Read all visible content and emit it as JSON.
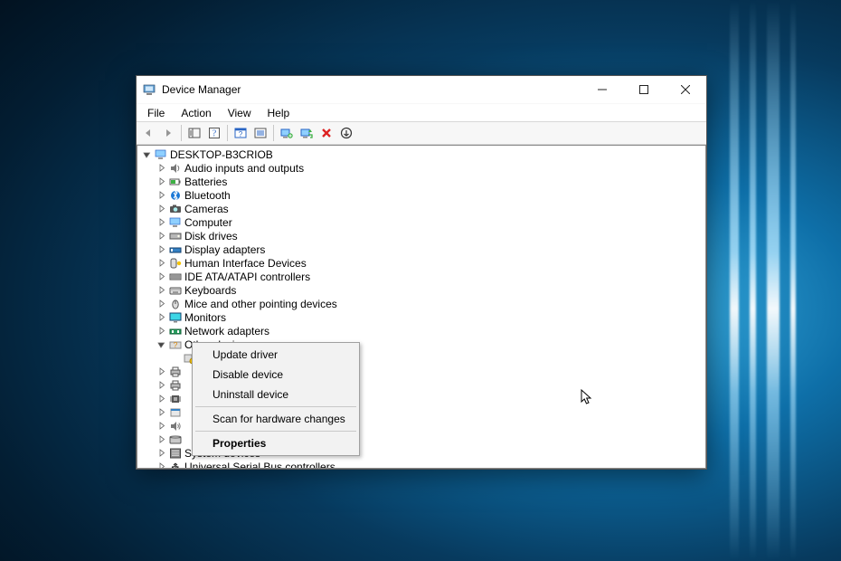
{
  "window": {
    "title": "Device Manager",
    "menu": [
      "File",
      "Action",
      "View",
      "Help"
    ],
    "toolbar": [
      {
        "name": "back-icon",
        "disabled": true
      },
      {
        "name": "forward-icon",
        "disabled": true
      },
      {
        "sep": true
      },
      {
        "name": "show-hide-tree-icon",
        "disabled": false
      },
      {
        "name": "help-topics-icon",
        "disabled": false
      },
      {
        "sep": true
      },
      {
        "name": "properties-window-icon",
        "disabled": false
      },
      {
        "name": "list-icon",
        "disabled": false
      },
      {
        "sep": true
      },
      {
        "name": "update-driver-icon",
        "disabled": false
      },
      {
        "name": "scan-hardware-icon",
        "disabled": false
      },
      {
        "name": "uninstall-device-icon",
        "disabled": false
      },
      {
        "name": "add-legacy-hardware-icon",
        "disabled": false
      }
    ]
  },
  "tree": {
    "root": {
      "label": "DESKTOP-B3CRIOB",
      "icon": "computer-icon",
      "expanded": true
    },
    "categories": [
      {
        "label": "Audio inputs and outputs",
        "icon": "audio-icon",
        "expanded": false
      },
      {
        "label": "Batteries",
        "icon": "battery-icon",
        "expanded": false
      },
      {
        "label": "Bluetooth",
        "icon": "bluetooth-icon",
        "expanded": false
      },
      {
        "label": "Cameras",
        "icon": "camera-icon",
        "expanded": false
      },
      {
        "label": "Computer",
        "icon": "computer-icon",
        "expanded": false
      },
      {
        "label": "Disk drives",
        "icon": "disk-icon",
        "expanded": false
      },
      {
        "label": "Display adapters",
        "icon": "display-adapter-icon",
        "expanded": false
      },
      {
        "label": "Human Interface Devices",
        "icon": "hid-icon",
        "expanded": false
      },
      {
        "label": "IDE ATA/ATAPI controllers",
        "icon": "ide-icon",
        "expanded": false
      },
      {
        "label": "Keyboards",
        "icon": "keyboard-icon",
        "expanded": false
      },
      {
        "label": "Mice and other pointing devices",
        "icon": "mouse-icon",
        "expanded": false
      },
      {
        "label": "Monitors",
        "icon": "monitor-icon",
        "expanded": false
      },
      {
        "label": "Network adapters",
        "icon": "network-icon",
        "expanded": false
      },
      {
        "label": "Other devices",
        "icon": "other-icon",
        "expanded": true
      },
      {
        "label": "",
        "icon": "unknown-icon",
        "expanded": false,
        "level": 2
      },
      {
        "label": "",
        "icon": "printer-icon",
        "expanded": false,
        "partial": true
      },
      {
        "label": "",
        "icon": "printer-icon",
        "expanded": false,
        "partial": true
      },
      {
        "label": "",
        "icon": "processor-icon",
        "expanded": false,
        "partial": true
      },
      {
        "label": "",
        "icon": "software-icon",
        "expanded": false,
        "partial": true
      },
      {
        "label": "",
        "icon": "sound-icon",
        "expanded": false,
        "partial": true
      },
      {
        "label": "",
        "icon": "storage-icon",
        "expanded": false,
        "partial": true
      },
      {
        "label": "System devices",
        "icon": "system-icon",
        "expanded": false
      },
      {
        "label": "Universal Serial Bus controllers",
        "icon": "usb-icon",
        "expanded": false
      }
    ]
  },
  "context_menu": {
    "items": [
      {
        "label": "Update driver",
        "name": "ctx-update-driver"
      },
      {
        "label": "Disable device",
        "name": "ctx-disable-device"
      },
      {
        "label": "Uninstall device",
        "name": "ctx-uninstall-device"
      },
      {
        "sep": true
      },
      {
        "label": "Scan for hardware changes",
        "name": "ctx-scan-hardware"
      },
      {
        "sep": true
      },
      {
        "label": "Properties",
        "name": "ctx-properties",
        "default": true
      }
    ]
  }
}
